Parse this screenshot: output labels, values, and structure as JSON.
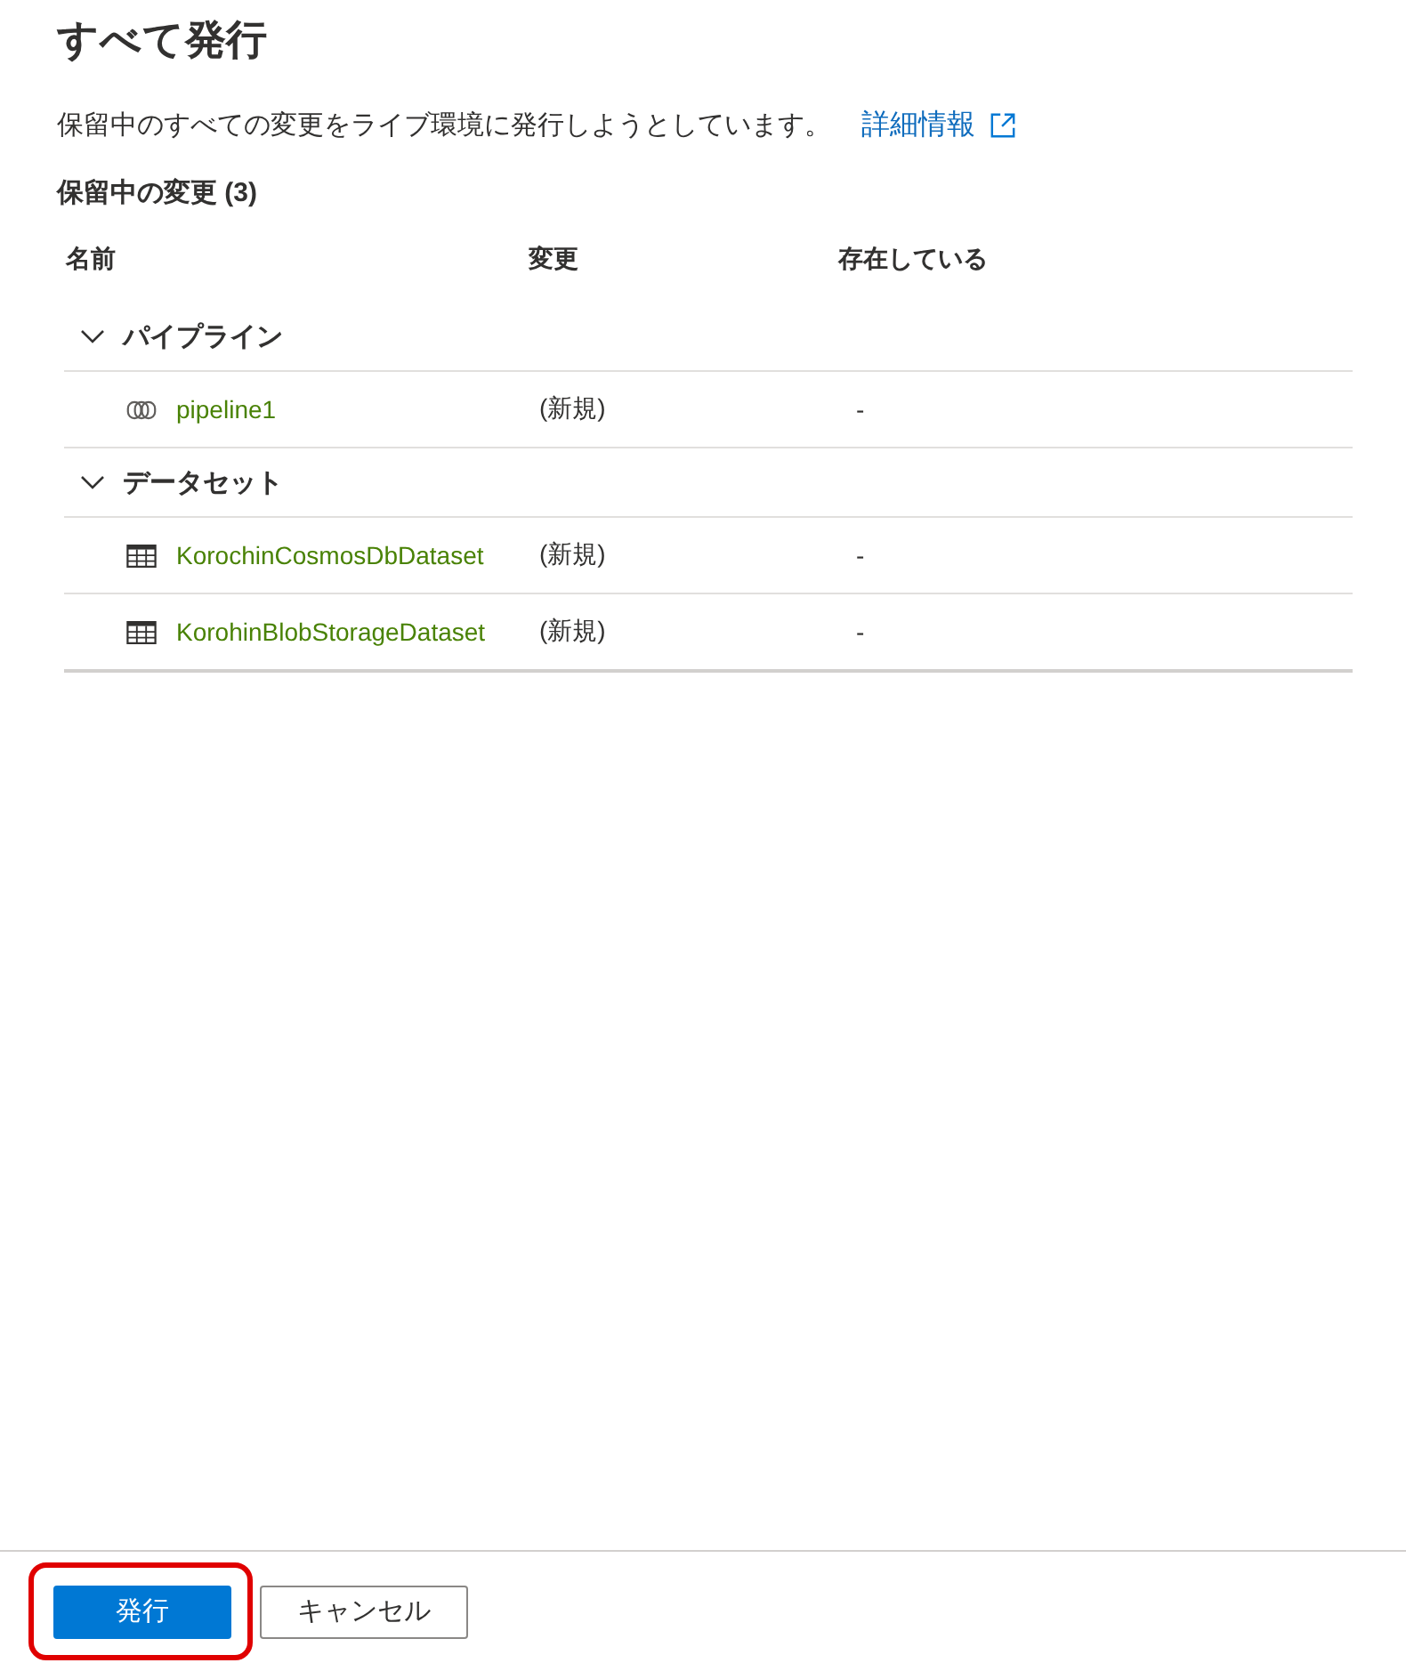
{
  "title": "すべて発行",
  "description": {
    "text": "保留中のすべての変更をライブ環境に発行しようとしています。",
    "link": "詳細情報"
  },
  "section_title": "保留中の変更 (3)",
  "table": {
    "columns": [
      "名前",
      "変更",
      "存在している"
    ],
    "groups": [
      {
        "label": "パイプライン",
        "expanded": true,
        "rows": [
          {
            "kind": "pipeline",
            "name": "pipeline1",
            "change": "(新規)",
            "exists": "-"
          }
        ]
      },
      {
        "label": "データセット",
        "expanded": true,
        "rows": [
          {
            "kind": "dataset",
            "name": "KorochinCosmosDbDataset",
            "change": "(新規)",
            "exists": "-"
          },
          {
            "kind": "dataset",
            "name": "KorohinBlobStorageDataset",
            "change": "(新規)",
            "exists": "-"
          }
        ]
      }
    ]
  },
  "footer": {
    "buttons": [
      {
        "label": "発行",
        "kind": "primary",
        "highlighted": true
      },
      {
        "label": "キャンセル",
        "kind": "secondary",
        "highlighted": false
      }
    ]
  }
}
